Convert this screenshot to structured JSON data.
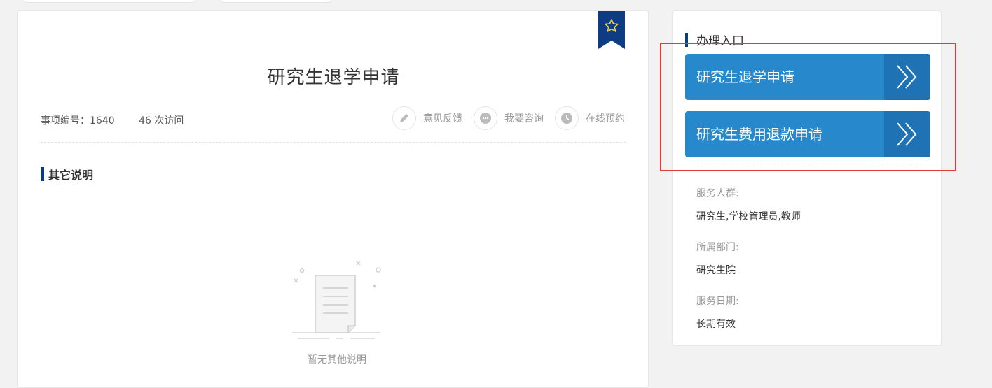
{
  "main": {
    "title": "研究生退学申请",
    "item_number": "事项编号：1640",
    "visits": "46 次访问",
    "actions": [
      {
        "label": "意见反馈",
        "icon": "pencil-icon"
      },
      {
        "label": "我要咨询",
        "icon": "chat-icon"
      },
      {
        "label": "在线预约",
        "icon": "clock-icon"
      }
    ],
    "section_title": "其它说明",
    "empty_text": "暂无其他说明"
  },
  "side": {
    "title": "办理入口",
    "entries": [
      {
        "label": "研究生退学申请"
      },
      {
        "label": "研究生费用退款申请"
      }
    ],
    "info": [
      {
        "label": "服务人群:",
        "value": "研究生,学校管理员,教师"
      },
      {
        "label": "所属部门:",
        "value": "研究生院"
      },
      {
        "label": "服务日期:",
        "value": "长期有效"
      }
    ]
  },
  "colors": {
    "accent_dark": "#0e3c82",
    "button_blue": "#2789cc",
    "button_blue_dark": "#1f72b3",
    "highlight_red": "#e03b3b"
  }
}
